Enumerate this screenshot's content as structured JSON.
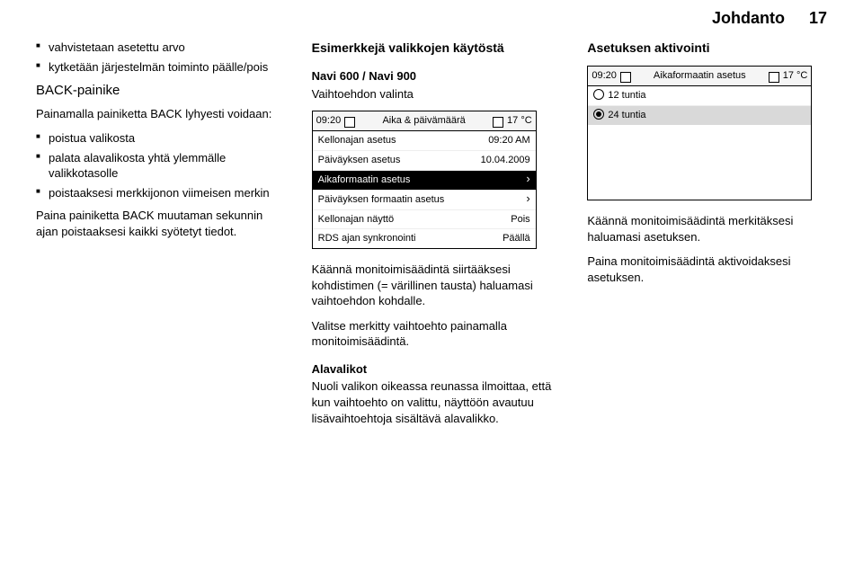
{
  "header": {
    "section": "Johdanto",
    "page": "17"
  },
  "col1": {
    "intro_list": [
      "vahvistetaan asetettu arvo",
      "kytketään järjestelmän toiminto päälle/pois"
    ],
    "back_heading": "BACK-painike",
    "back_intro": "Painamalla painiketta BACK lyhyesti voidaan:",
    "back_list": [
      "poistua valikosta",
      "palata alavalikosta yhtä ylemmälle valikkotasolle",
      "poistaaksesi merkkijonon viimeisen merkin"
    ],
    "back_para": "Paina painiketta BACK muutaman sekunnin ajan poistaaksesi kaikki syötetyt tiedot."
  },
  "col2": {
    "heading": "Esimerkkejä valikkojen käytöstä",
    "sub1": "Navi 600 / Navi 900",
    "sub2": "Vaihtoehdon valinta",
    "shot": {
      "time": "09:20",
      "title": "Aika & päivämäärä",
      "temp": "17 °C",
      "rows": [
        {
          "label": "Kellonajan asetus",
          "value": "09:20 AM"
        },
        {
          "label": "Päiväyksen asetus",
          "value": "10.04.2009"
        },
        {
          "label": "Aikaformaatin asetus",
          "value": "",
          "sel": true,
          "chev": true
        },
        {
          "label": "Päiväyksen formaatin asetus",
          "value": "",
          "chev": true
        },
        {
          "label": "Kellonajan näyttö",
          "value": "Pois"
        },
        {
          "label": "RDS ajan synkronointi",
          "value": "Päällä"
        }
      ]
    },
    "p1": "Käännä monitoimisäädintä siirtääksesi kohdistimen (= värillinen tausta) haluamasi vaihtoehdon kohdalle.",
    "p2": "Valitse merkitty vaihtoehto painamalla monitoimisäädintä.",
    "sub3": "Alavalikot",
    "p3": "Nuoli valikon oikeassa reunassa ilmoittaa, että kun vaihtoehto on valittu, näyttöön avautuu lisävaihtoehtoja sisältävä alavalikko."
  },
  "col3": {
    "heading": "Asetuksen aktivointi",
    "shot": {
      "time": "09:20",
      "title": "Aikaformaatin asetus",
      "temp": "17 °C",
      "opts": [
        {
          "label": "12 tuntia",
          "checked": false
        },
        {
          "label": "24 tuntia",
          "checked": true,
          "sel": true
        }
      ]
    },
    "p1": "Käännä monitoimisäädintä merkitäksesi haluamasi asetuksen.",
    "p2": "Paina monitoimisäädintä aktivoidaksesi asetuksen."
  }
}
